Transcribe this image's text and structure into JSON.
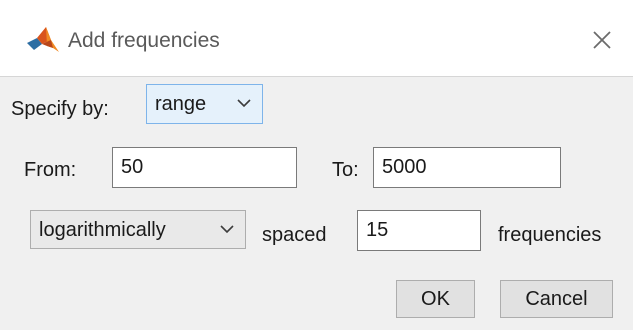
{
  "window": {
    "title": "Add frequencies",
    "icon": "matlab-logo-icon",
    "close_icon": "close-icon"
  },
  "specify": {
    "label": "Specify by:",
    "selected": "range"
  },
  "range": {
    "from_label": "From:",
    "from_value": "50",
    "to_label": "To:",
    "to_value": "5000"
  },
  "spacing": {
    "mode_selected": "logarithmically",
    "spaced_label": "spaced",
    "count_value": "15",
    "frequencies_label": "frequencies"
  },
  "buttons": {
    "ok_label": "OK",
    "cancel_label": "Cancel"
  },
  "colors": {
    "accent_select_bg": "#e5f1fb",
    "accent_select_border": "#7eb4ea",
    "panel_bg": "#f0f0f0"
  }
}
